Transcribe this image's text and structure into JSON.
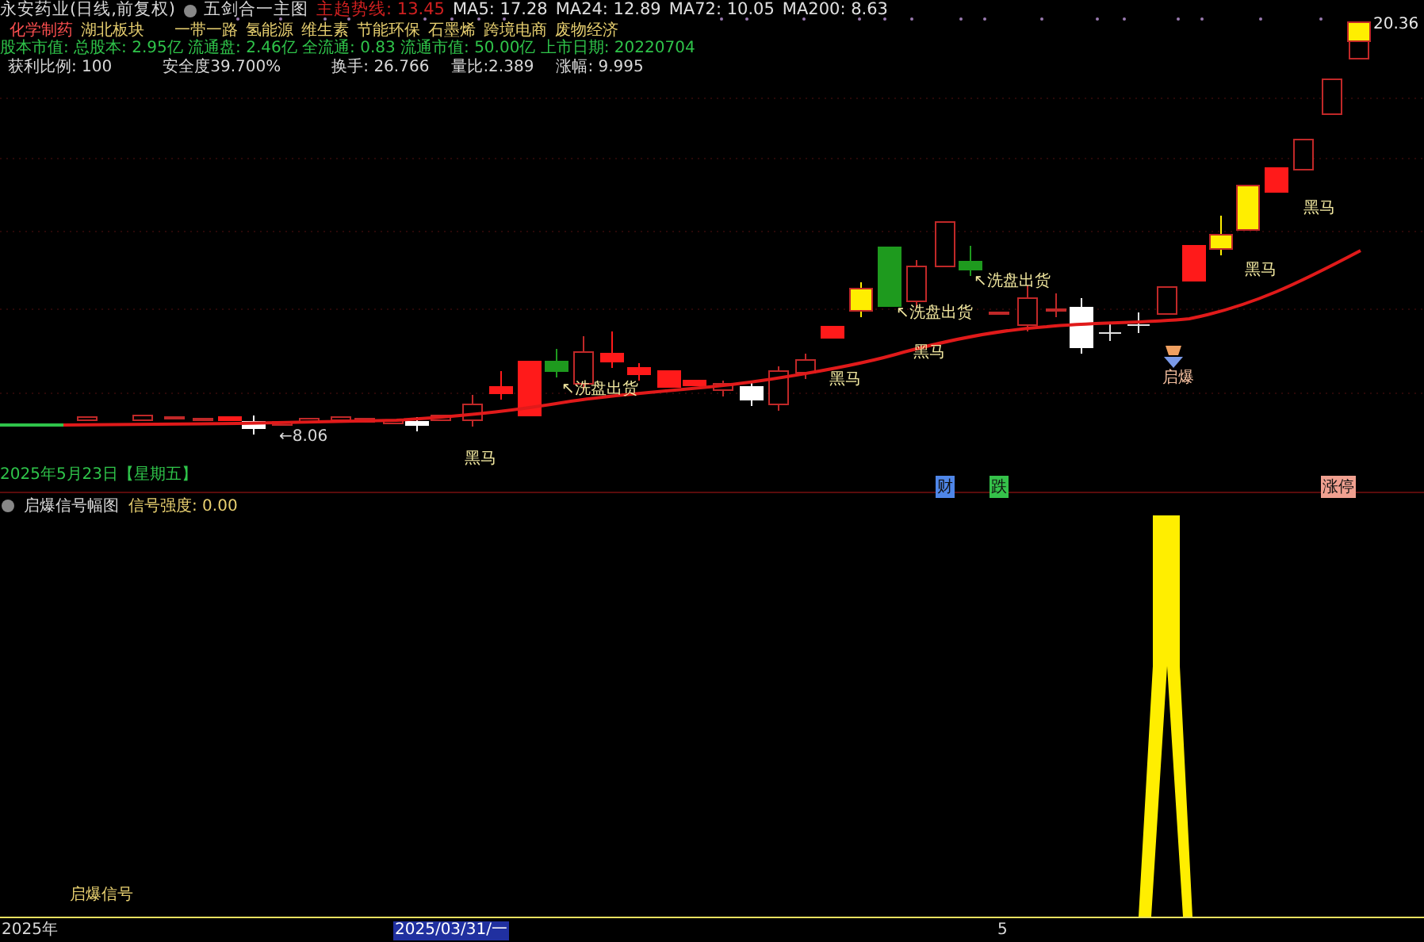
{
  "header": {
    "title": "永安药业(日线,前复权)",
    "indicator": "五剑合一主图",
    "values": [
      {
        "label": "主趋势线: 13.45",
        "kind": "trend"
      },
      {
        "label": "MA5: 17.28",
        "kind": "ma"
      },
      {
        "label": "MA24: 12.89",
        "kind": "ma"
      },
      {
        "label": "MA72: 10.05",
        "kind": "ma"
      },
      {
        "label": "MA200: 8.63",
        "kind": "ma"
      }
    ]
  },
  "tags": [
    {
      "label": "化学制药",
      "kind": "industry"
    },
    {
      "label": "湖北板块",
      "kind": "region"
    },
    {
      "label": "一带一路",
      "kind": "concept"
    },
    {
      "label": "氢能源",
      "kind": "concept"
    },
    {
      "label": "维生素",
      "kind": "concept"
    },
    {
      "label": "节能环保",
      "kind": "concept"
    },
    {
      "label": "石墨烯",
      "kind": "concept"
    },
    {
      "label": "跨境电商",
      "kind": "concept"
    },
    {
      "label": "废物经济",
      "kind": "concept"
    }
  ],
  "stats_line": "股本市值: 总股本: 2.95亿 流通盘: 2.46亿 全流通: 0.83 流通市值: 50.00亿 上市日期: 20220704",
  "metrics": [
    "获利比例: 100",
    "安全度39.700%",
    "换手: 26.766",
    "量比:2.389",
    "涨幅: 9.995"
  ],
  "chart": {
    "last_price": "20.36",
    "low_price": "←8.06",
    "annotations": [
      {
        "text": "↖洗盘出货",
        "kind": "signal"
      },
      {
        "text": "↖洗盘出货",
        "kind": "signal"
      },
      {
        "text": "↖洗盘出货",
        "kind": "signal"
      },
      {
        "text": "黑马",
        "kind": "signal"
      },
      {
        "text": "黑马",
        "kind": "signal"
      },
      {
        "text": "黑马",
        "kind": "signal"
      },
      {
        "text": "黑马",
        "kind": "signal"
      },
      {
        "text": "黑马",
        "kind": "signal"
      },
      {
        "text": "启爆",
        "kind": "launch"
      }
    ],
    "date": "2025年5月23日【星期五】",
    "events": [
      {
        "label": "财",
        "color": "#4f86e8"
      },
      {
        "label": "跌",
        "color": "#35c24a"
      },
      {
        "label": "涨停",
        "color": "#f0a090"
      }
    ]
  },
  "indicator": {
    "title": "启爆信号幅图",
    "reading": "信号强度: 0.00",
    "series_label": "启爆信号"
  },
  "time_axis": [
    {
      "label": "2025年",
      "selected": false
    },
    {
      "label": "2025/03/31/一",
      "selected": true
    },
    {
      "label": "5",
      "selected": false
    }
  ]
}
